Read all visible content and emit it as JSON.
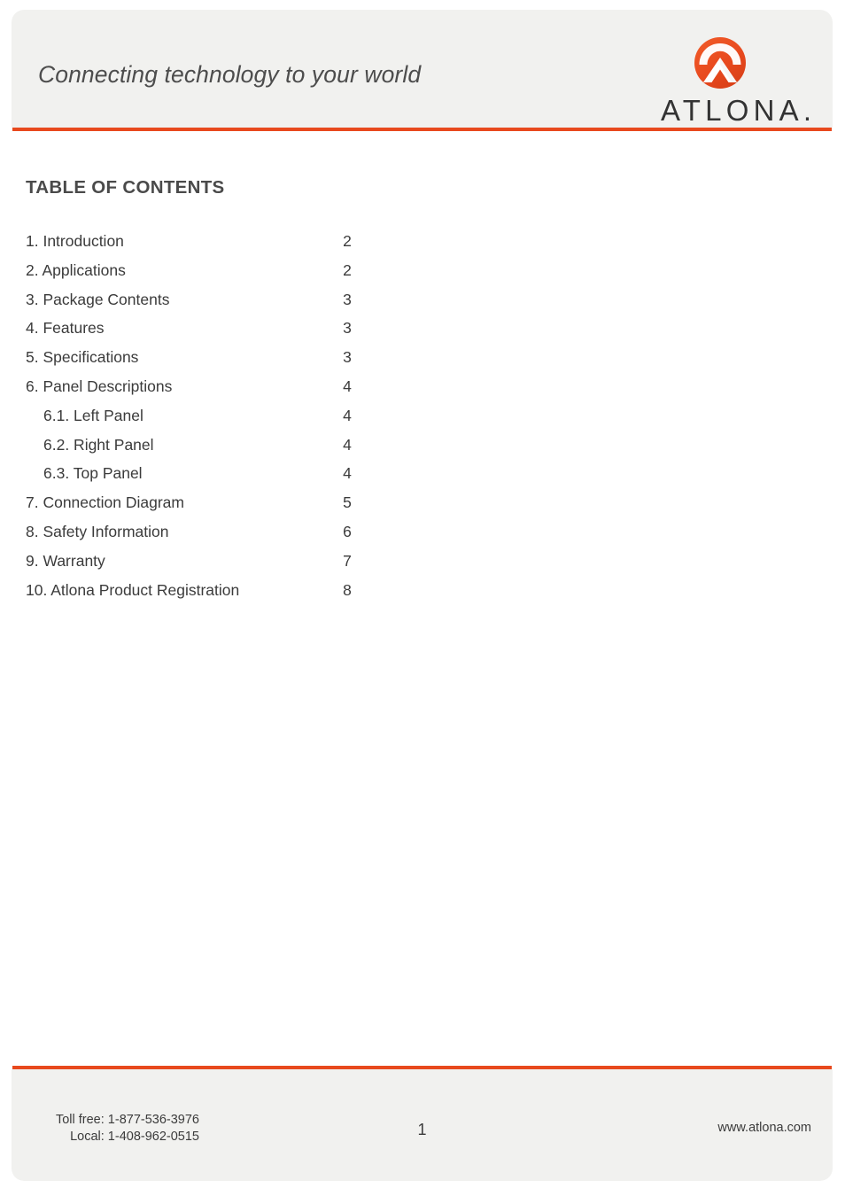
{
  "header": {
    "tagline": "Connecting technology to your world",
    "logo_wordmark": "ATLONA",
    "logo_wordmark_suffix": ".",
    "logo_icon": "atlona-chevron-badge-icon",
    "accent_color": "#e8491e",
    "band_color": "#f1f1ef"
  },
  "toc": {
    "title": "TABLE OF CONTENTS",
    "entries": [
      {
        "label": "1. Introduction",
        "page": "2",
        "level": 1
      },
      {
        "label": "2. Applications",
        "page": "2",
        "level": 1
      },
      {
        "label": "3. Package Contents",
        "page": "3",
        "level": 1
      },
      {
        "label": "4. Features",
        "page": "3",
        "level": 1
      },
      {
        "label": "5. Specifications",
        "page": "3",
        "level": 1
      },
      {
        "label": "6. Panel Descriptions",
        "page": "4",
        "level": 1
      },
      {
        "label": "6.1. Left Panel",
        "page": "4",
        "level": 2
      },
      {
        "label": "6.2. Right Panel",
        "page": "4",
        "level": 2
      },
      {
        "label": "6.3. Top Panel",
        "page": "4",
        "level": 2
      },
      {
        "label": "7. Connection Diagram",
        "page": "5",
        "level": 1
      },
      {
        "label": "8. Safety Information",
        "page": "6",
        "level": 1
      },
      {
        "label": "9. Warranty",
        "page": "7",
        "level": 1
      },
      {
        "label": "10. Atlona Product Registration",
        "page": "8",
        "level": 1
      }
    ]
  },
  "footer": {
    "toll_free": "Toll free: 1-877-536-3976",
    "local": "Local: 1-408-962-0515",
    "page_number": "1",
    "website": "www.atlona.com"
  }
}
